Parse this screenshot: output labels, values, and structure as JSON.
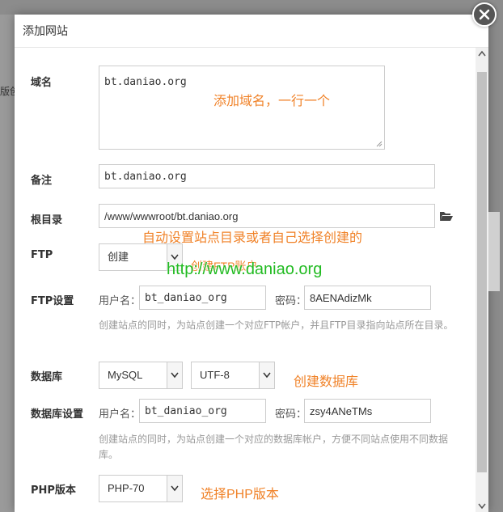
{
  "background": {
    "partial_text": "版创"
  },
  "dialog": {
    "title": "添加网站",
    "close_icon": "close-icon"
  },
  "form": {
    "domain": {
      "label": "域名",
      "value": "bt.daniao.org"
    },
    "note": {
      "label": "备注",
      "value": "bt.daniao.org"
    },
    "root": {
      "label": "根目录",
      "value": "/www/wwwroot/bt.daniao.org",
      "icon": "folder-open-icon"
    },
    "ftp": {
      "label": "FTP",
      "selected": "创建"
    },
    "ftp_settings": {
      "label": "FTP设置",
      "user_label": "用户名：",
      "user_value": "bt_daniao_org",
      "pass_label": "密码：",
      "pass_value": "8AENAdizMk",
      "help": "创建站点的同时，为站点创建一个对应FTP帐户，并且FTP目录指向站点所在目录。"
    },
    "database": {
      "label": "数据库",
      "type_selected": "MySQL",
      "charset_selected": "UTF-8"
    },
    "db_settings": {
      "label": "数据库设置",
      "user_label": "用户名：",
      "user_value": "bt_daniao_org",
      "pass_label": "密码：",
      "pass_value": "zsy4ANeTMs",
      "help": "创建站点的同时，为站点创建一个对应的数据库帐户，方便不同站点使用不同数据库。"
    },
    "php": {
      "label": "PHP版本",
      "selected": "PHP-70"
    }
  },
  "annotations": {
    "domain_hint": "添加域名，一行一个",
    "root_hint": "自动设置站点目录或者自己选择创建的",
    "ftp_hint": "创建FTP账户",
    "watermark": "http://www.daniao.org",
    "db_hint": "创建数据库",
    "php_hint": "选择PHP版本"
  },
  "colors": {
    "annotation": "#f08228",
    "watermark": "#22bb22"
  }
}
